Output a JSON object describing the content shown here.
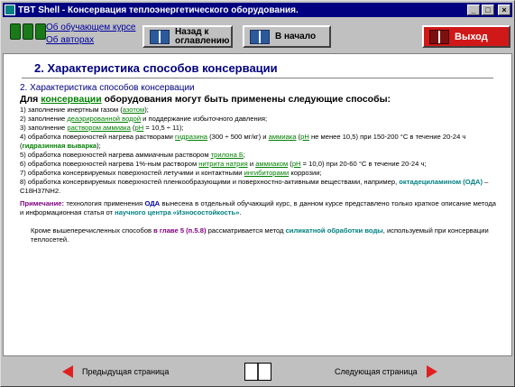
{
  "window": {
    "title": "TBT Shell - Консервация теплоэнергетического оборудования.",
    "controls": {
      "minimize": "_",
      "maximize": "□",
      "close": "×"
    }
  },
  "toolbar": {
    "link_about_course": "Об обучающем курсе",
    "link_about_authors": "Об авторах",
    "back_label": "Назад к оглавлению",
    "home_label": "В начало",
    "exit_label": "Выход"
  },
  "content": {
    "page_title": "2. Характеристика способов консервации",
    "section_title": "2. Характеристика способов консервации",
    "lead_before": "Для ",
    "lead_kw": "консервации",
    "lead_after": " оборудования могут быть применены следующие способы:",
    "items": {
      "i1_a": "1) заполнение инертным газом (",
      "i1_link": "азотом",
      "i1_b": ");",
      "i2_a": "2) заполнение ",
      "i2_link": "деаэрированной водой",
      "i2_b": " и поддержание избыточного давления;",
      "i3_a": "3) заполнение ",
      "i3_link": "раствором аммиака",
      "i3_b": " (",
      "i3_ph": "рН",
      "i3_c": " = 10,5 ÷ 11);",
      "i4_a": "4) обработка поверхностей нагрева растворами ",
      "i4_link1": "гидразина",
      "i4_b": " (300 ÷ 500 мг/кг) и ",
      "i4_link2": "аммиака",
      "i4_c": " (",
      "i4_ph": "рН",
      "i4_d": " не менее 10,5) при 150-200 °С в течение 20-24 ч (",
      "i4_bold": "гидразинная выварка",
      "i4_e": ");",
      "i5_a": "5) обработка поверхностей нагрева аммиачным раствором ",
      "i5_link": "трилона Б",
      "i5_b": ";",
      "i6_a": "6) обработка поверхностей нагрева 1%-ным раствором ",
      "i6_link1": "нитрита натрия",
      "i6_b": " и ",
      "i6_link2": "аммиаком",
      "i6_c": " (",
      "i6_ph": "рН",
      "i6_d": " = 10,0) при 20-60 °С в течение 20-24 ч;",
      "i7_a": "7) обработка консервируемых поверхностей летучими и контактными ",
      "i7_link": "ингибиторами",
      "i7_b": " коррозии;",
      "i8_a": "8) обработка консервируемых поверхностей пленкообразующими и поверхностно-активными веществами, например, ",
      "i8_bold": "октадециламином (ОДА)",
      "i8_b": " – C18H37NH2."
    },
    "note_label": "Примечание:",
    "note_a": " технология применения ",
    "note_oda": "ОДА",
    "note_b": " вынесена в отдельный обучающий курс, в данном курсе представлено только краткое описание метода и информационная статья от ",
    "note_center": "научного центра «Износостойкость»",
    "note_c": ".",
    "tail_a": "Кроме вышеперечисленных способов ",
    "tail_chapter": "в главе 5 (п.5.8)",
    "tail_b": " рассматривается метод ",
    "tail_method": "силикатной обработки воды",
    "tail_c": ", используемый при консервации теплосетей."
  },
  "footer": {
    "prev_label": "Предыдущая страница",
    "next_label": "Следующая страница"
  },
  "colors": {
    "title_bar": "#000080",
    "link": "#008000",
    "heading": "#000080",
    "exit_button": "#d01818",
    "nav_arrow": "#e02020"
  },
  "icons": [
    "app-icon",
    "book-icon",
    "arrow-left-icon",
    "arrow-right-icon",
    "open-book-icon"
  ]
}
